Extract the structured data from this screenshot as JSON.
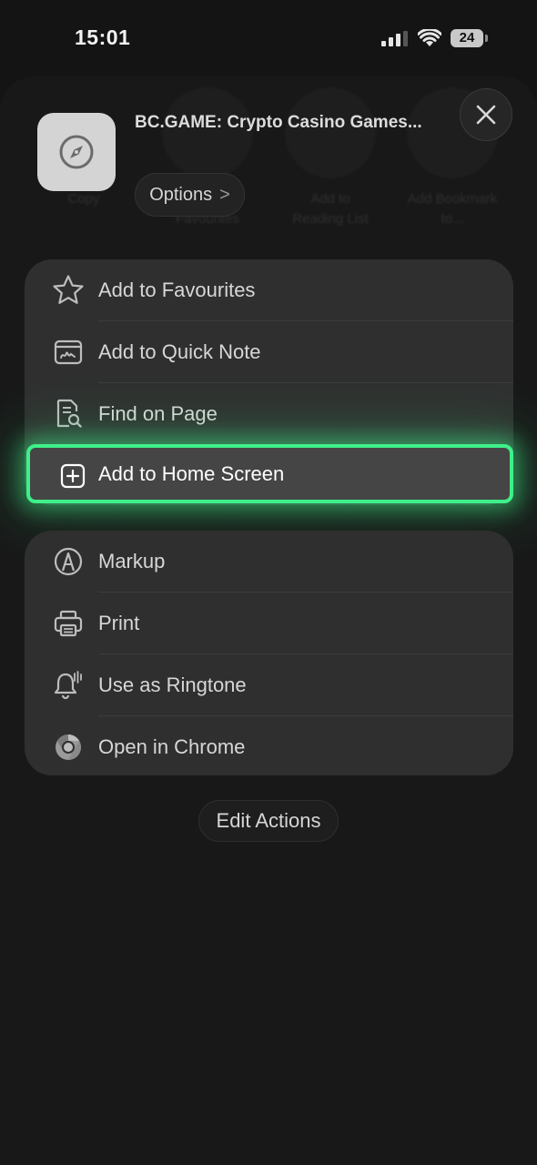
{
  "status_bar": {
    "time": "15:01",
    "battery": "24"
  },
  "ghost_row": [
    {
      "label": "Copy"
    },
    {
      "label": "Add to Favourites"
    },
    {
      "label": "Add to Reading List"
    },
    {
      "label": "Add Bookmark to..."
    }
  ],
  "header": {
    "title": "BC.GAME: Crypto Casino Games...",
    "options_label": "Options",
    "options_chevron": ">",
    "close_icon": "close-icon",
    "app_icon": "compass-icon"
  },
  "actions_group1": [
    {
      "label": "Add to Favourites",
      "icon": "star-icon"
    },
    {
      "label": "Add to Quick Note",
      "icon": "quick-note-icon"
    },
    {
      "label": "Find on Page",
      "icon": "find-on-page-icon"
    },
    {
      "label": "Add to Home Screen",
      "icon": "plus-square-icon",
      "highlighted": true
    }
  ],
  "actions_group2": [
    {
      "label": "Markup",
      "icon": "markup-icon"
    },
    {
      "label": "Print",
      "icon": "printer-icon"
    },
    {
      "label": "Use as Ringtone",
      "icon": "bell-ringtone-icon"
    },
    {
      "label": "Open in Chrome",
      "icon": "chrome-icon"
    }
  ],
  "edit_actions_label": "Edit Actions",
  "colors": {
    "highlight": "#3ff08a",
    "background": "#141414",
    "group": "#2f2f2f"
  }
}
